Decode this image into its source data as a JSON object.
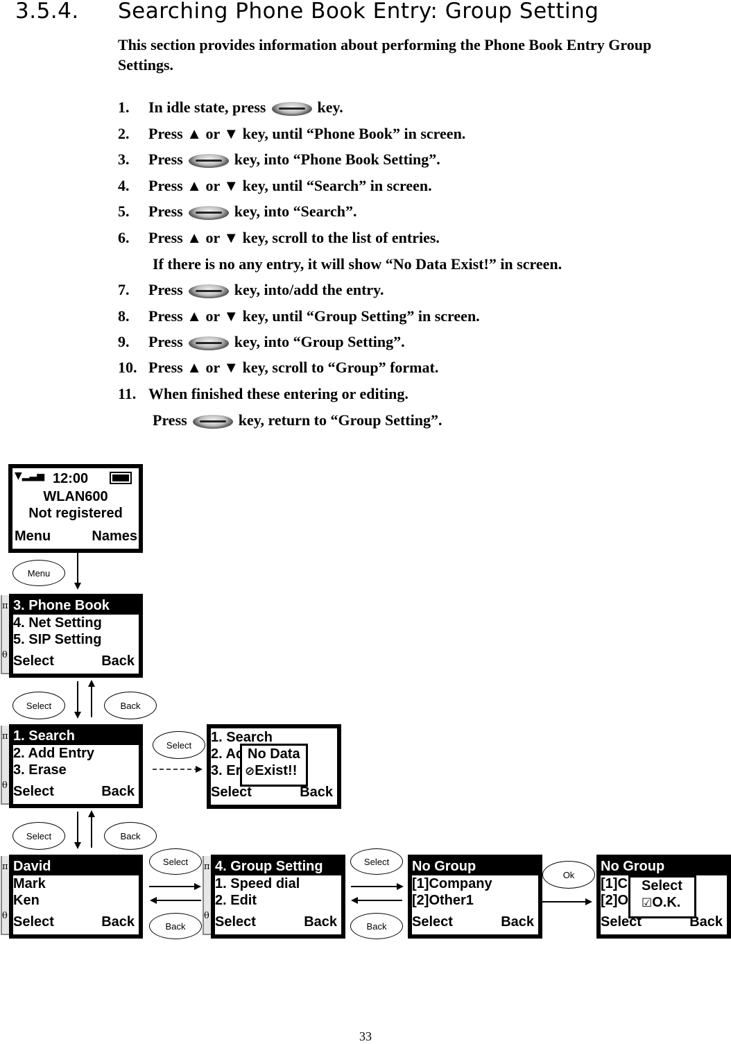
{
  "section": {
    "number": "3.5.4.",
    "title": "Searching Phone Book Entry: Group Setting"
  },
  "intro": "This section provides information about performing the Phone Book Entry Group Settings.",
  "steps": [
    {
      "n": "1.",
      "before": "In idle state, press",
      "key": "softkey-icon",
      "after": "key."
    },
    {
      "n": "2.",
      "before": "Press ▲ or ▼ key, until “Phone Book” in screen.",
      "after": ""
    },
    {
      "n": "3.",
      "before": "Press",
      "key": "softkey-icon",
      "after": "key, into “Phone Book Setting”."
    },
    {
      "n": "4.",
      "before": "Press ▲ or ▼ key, until “Search” in screen.",
      "after": ""
    },
    {
      "n": "5.",
      "before": "Press",
      "key": "softkey-icon",
      "after": "key, into “Search”."
    },
    {
      "n": "6.",
      "before": "Press ▲  or ▼  key, scroll to the list of entries.",
      "after": ""
    },
    {
      "n": "",
      "before": "If there is no any entry, it will show “No Data Exist!” in screen.",
      "after": ""
    },
    {
      "n": "7.",
      "before": "Press",
      "key": "softkey-icon",
      "after": "key, into/add the entry."
    },
    {
      "n": "8.",
      "before": "Press ▲ or ▼ key, until “Group Setting” in screen.",
      "after": ""
    },
    {
      "n": "9.",
      "before": "Press",
      "key": "softkey-icon",
      "after": "key, into “Group Setting”."
    },
    {
      "n": "10.",
      "before": "Press ▲  or ▼  key, scroll to “Group” format.",
      "after": ""
    },
    {
      "n": "11.",
      "before": "When finished these entering or editing.",
      "after": ""
    },
    {
      "n": "",
      "before": "Press",
      "key": "softkey-icon",
      "after": "key, return to “Group Setting”."
    }
  ],
  "screens": {
    "idle": {
      "time": "12:00",
      "line1": "WLAN600",
      "line2": "Not registered",
      "left": "Menu",
      "right": "Names",
      "icons": [
        "signal-icon",
        "battery-icon"
      ]
    },
    "menu": {
      "highlight": "3. Phone Book",
      "lines": [
        "4. Net Setting",
        "5. SIP Setting"
      ],
      "left": "Select",
      "right": "Back"
    },
    "phonebook": {
      "highlight": "1. Search",
      "lines": [
        "2. Add Entry",
        "3. Erase"
      ],
      "left": "Select",
      "right": "Back"
    },
    "nodata": {
      "lines": [
        "1. Search",
        "2. Ac",
        "3. Er"
      ],
      "popup": [
        "No Data",
        "Exist!!"
      ],
      "left": "Select",
      "right": "Back"
    },
    "entries": {
      "highlight": "David",
      "lines": [
        "Mark",
        "Ken"
      ],
      "left": "Select",
      "right": "Back"
    },
    "entry_menu": {
      "highlight": "4. Group Setting",
      "lines": [
        "1. Speed dial",
        "2. Edit"
      ],
      "left": "Select",
      "right": "Back"
    },
    "groups": {
      "highlight": "No Group",
      "lines": [
        "[1]Company",
        "[2]Other1"
      ],
      "left": "Select",
      "right": "Back"
    },
    "confirm": {
      "highlight": "No Group",
      "lines": [
        "[1]C",
        "[2]O"
      ],
      "popup": [
        "Select",
        "O.K."
      ],
      "left": "Select",
      "right": "Back"
    }
  },
  "scroll_symbols": {
    "up": "π",
    "down": "θ"
  },
  "keys": {
    "menu": "Menu",
    "select": "Select",
    "back": "Back",
    "ok": "Ok"
  },
  "page_number": "33"
}
